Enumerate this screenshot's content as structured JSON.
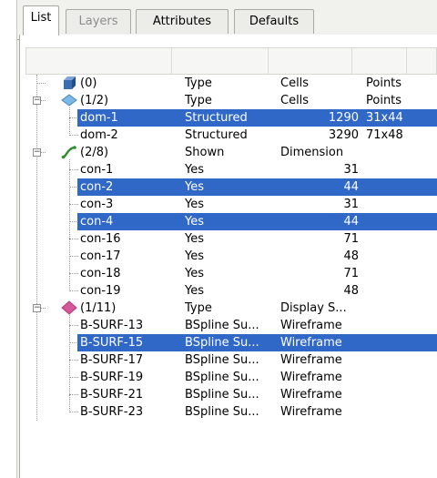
{
  "tabs": [
    {
      "label": "List",
      "state": "active"
    },
    {
      "label": "Layers",
      "state": "disabled"
    },
    {
      "label": "Attributes",
      "state": "normal"
    },
    {
      "label": "Defaults",
      "state": "normal"
    }
  ],
  "header_columns": [
    "",
    "",
    "",
    "",
    ""
  ],
  "colors": {
    "selection": "#3068c8",
    "selected_text": "#ffffff",
    "icon_block": "#3a6fb0",
    "icon_domain": "#7ab8e8",
    "icon_connector": "#2f8f2f",
    "icon_surface": "#d4589a"
  },
  "groups": [
    {
      "icon": "block-cube-icon",
      "count": "(0)",
      "columns": [
        "Type",
        "Cells",
        "Points"
      ],
      "expander": "none",
      "items": []
    },
    {
      "icon": "domain-diamond-icon",
      "count": "(1/2)",
      "columns": [
        "Type",
        "Cells",
        "Points"
      ],
      "expander": "−",
      "items": [
        {
          "name": "dom-1",
          "type": "Structured",
          "cells": "1290",
          "points": "31x44",
          "selected": true
        },
        {
          "name": "dom-2",
          "type": "Structured",
          "cells": "3290",
          "points": "71x48",
          "selected": false
        }
      ]
    },
    {
      "icon": "connector-curve-icon",
      "count": "(2/8)",
      "columns": [
        "Shown",
        "Dimension",
        ""
      ],
      "expander": "−",
      "items": [
        {
          "name": "con-1",
          "type": "Yes",
          "cells": "31",
          "selected": false
        },
        {
          "name": "con-2",
          "type": "Yes",
          "cells": "44",
          "selected": true
        },
        {
          "name": "con-3",
          "type": "Yes",
          "cells": "31",
          "selected": false
        },
        {
          "name": "con-4",
          "type": "Yes",
          "cells": "44",
          "selected": true
        },
        {
          "name": "con-16",
          "type": "Yes",
          "cells": "71",
          "selected": false
        },
        {
          "name": "con-17",
          "type": "Yes",
          "cells": "48",
          "selected": false
        },
        {
          "name": "con-18",
          "type": "Yes",
          "cells": "71",
          "selected": false
        },
        {
          "name": "con-19",
          "type": "Yes",
          "cells": "48",
          "selected": false
        }
      ]
    },
    {
      "icon": "database-surface-icon",
      "count": "(1/11)",
      "columns": [
        "Type",
        "Display S...",
        ""
      ],
      "expander": "−",
      "items": [
        {
          "name": "B-SURF-13",
          "type": "BSpline Su...",
          "cells": "Wireframe",
          "selected": false
        },
        {
          "name": "B-SURF-15",
          "type": "BSpline Su...",
          "cells": "Wireframe",
          "selected": true
        },
        {
          "name": "B-SURF-17",
          "type": "BSpline Su...",
          "cells": "Wireframe",
          "selected": false
        },
        {
          "name": "B-SURF-19",
          "type": "BSpline Su...",
          "cells": "Wireframe",
          "selected": false
        },
        {
          "name": "B-SURF-21",
          "type": "BSpline Su...",
          "cells": "Wireframe",
          "selected": false
        },
        {
          "name": "B-SURF-23",
          "type": "BSpline Su...",
          "cells": "Wireframe",
          "selected": false
        }
      ]
    }
  ]
}
